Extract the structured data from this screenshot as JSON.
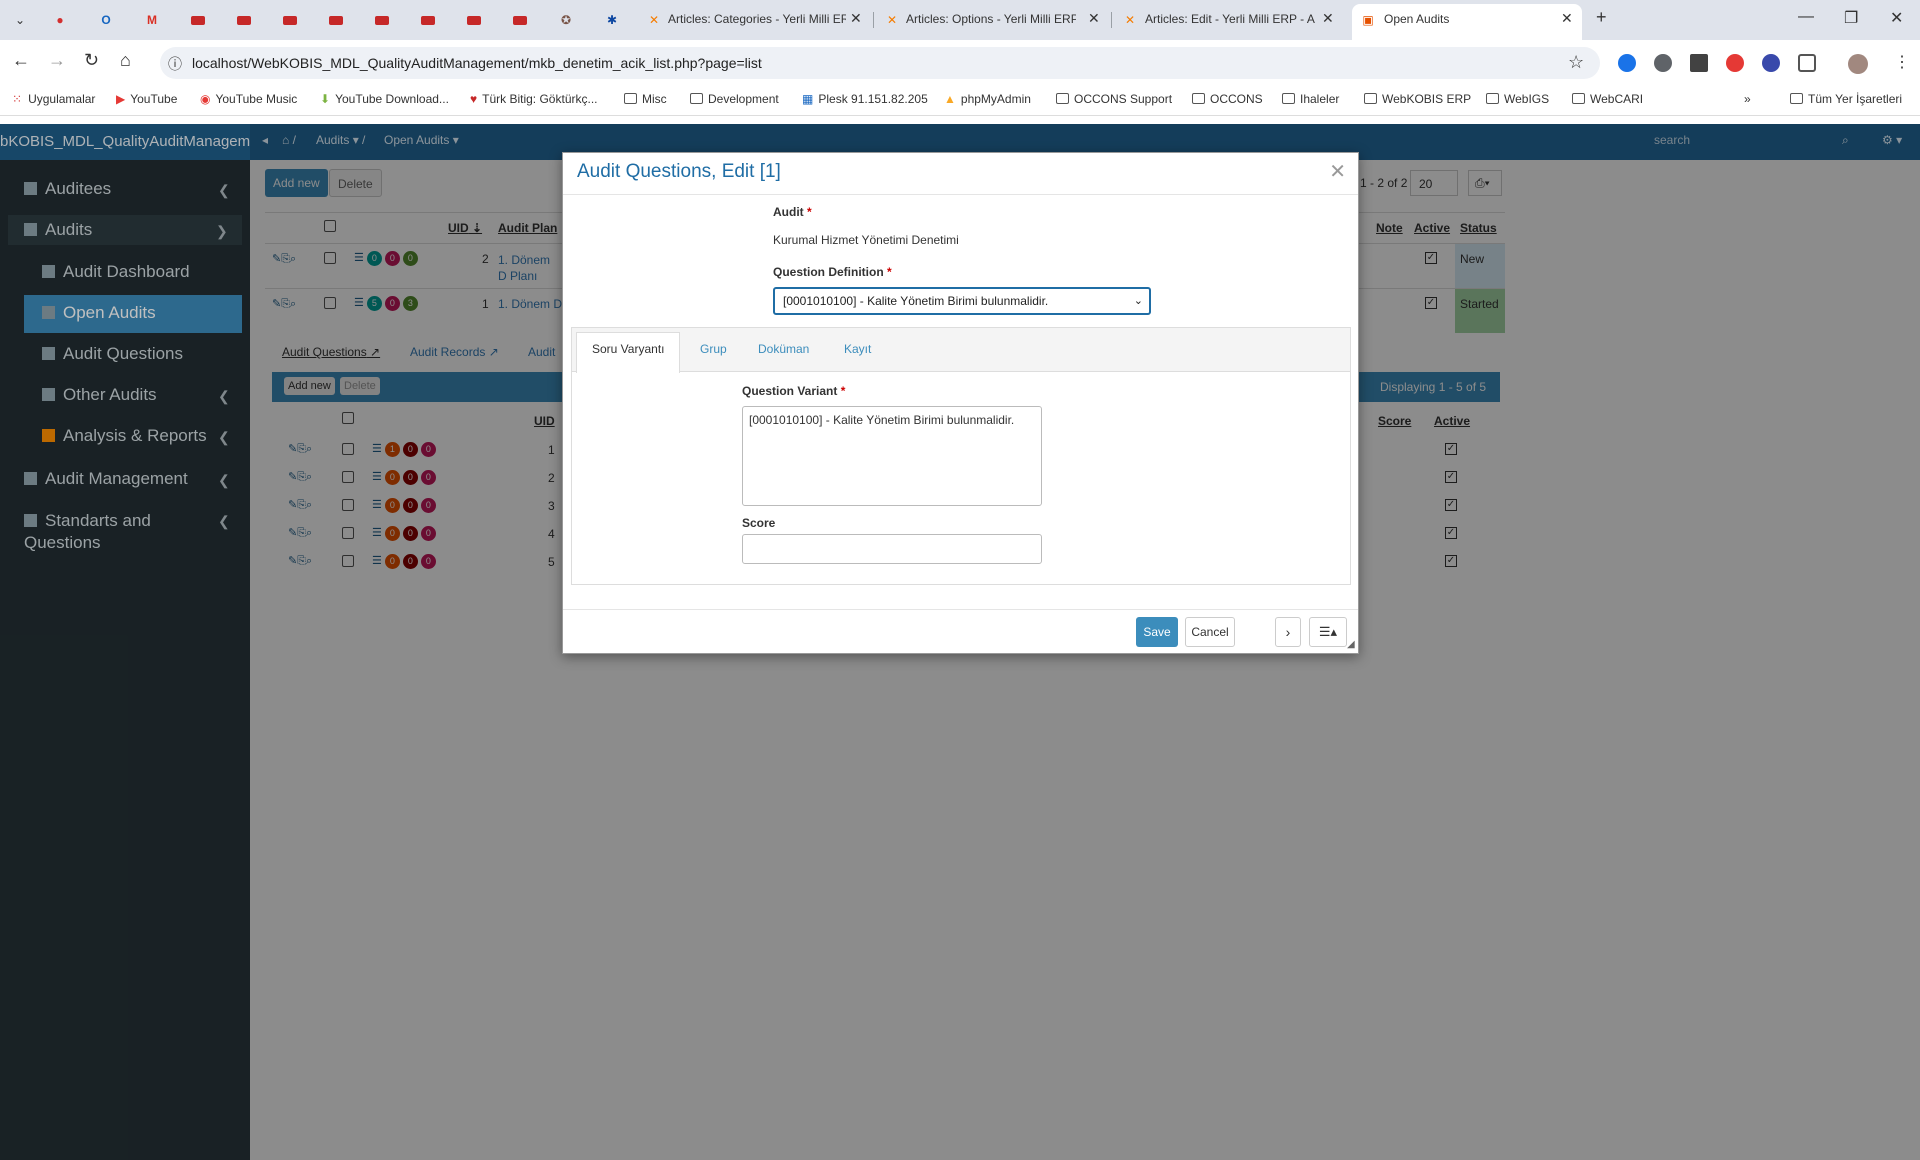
{
  "browser": {
    "tabs": [
      {
        "title": "Articles: Categories - Yerli Milli ERP"
      },
      {
        "title": "Articles: Options - Yerli Milli ERP"
      },
      {
        "title": "Articles: Edit - Yerli Milli ERP - A"
      },
      {
        "title": "Open Audits"
      }
    ],
    "url": "localhost/WebKOBIS_MDL_QualityAuditManagement/mkb_denetim_acik_list.php?page=list",
    "bookmarks": [
      "Uygulamalar",
      "YouTube",
      "YouTube Music",
      "YouTube Download...",
      "Türk Bitig: Göktürkç...",
      "Misc",
      "Development",
      "Plesk 91.151.82.205",
      "phpMyAdmin",
      "OCCONS Support",
      "OCCONS",
      "Ihaleler",
      "WebKOBIS ERP",
      "WebIGS",
      "WebCARI"
    ],
    "all_bookmarks": "Tüm Yer İşaretleri"
  },
  "app": {
    "brand": "bKOBIS_MDL_QualityAuditManagem",
    "breadcrumb": [
      "Audits",
      "Open Audits"
    ],
    "search_placeholder": "search"
  },
  "sidebar": {
    "items": [
      {
        "label": "Auditees"
      },
      {
        "label": "Audits"
      },
      {
        "label": "Audit Dashboard"
      },
      {
        "label": "Open Audits"
      },
      {
        "label": "Audit Questions"
      },
      {
        "label": "Other Audits"
      },
      {
        "label": "Analysis & Reports"
      },
      {
        "label": "Audit Management"
      },
      {
        "label": "Standarts and Questions"
      }
    ]
  },
  "list": {
    "add_new": "Add new",
    "delete": "Delete",
    "pager": "1 - 2 of 2",
    "page_size": "20",
    "headers": [
      "UID",
      "Audit Plan",
      "Note",
      "Active",
      "Status"
    ],
    "rows": [
      {
        "uid": "2",
        "plan": "1. Dönem D Planı",
        "status": "New",
        "pills": [
          "0",
          "0",
          "0"
        ]
      },
      {
        "uid": "1",
        "plan": "1. Dönem D",
        "status": "Started",
        "pills": [
          "5",
          "0",
          "3"
        ]
      }
    ],
    "detail_tabs": [
      "Audit Questions",
      "Audit Records",
      "Audit"
    ],
    "detail_display": "Displaying 1 - 5 of 5",
    "detail_headers": [
      "UID",
      "Score",
      "Active"
    ],
    "detail_rows": [
      {
        "uid": "1",
        "pills": [
          "1",
          "0",
          "0"
        ]
      },
      {
        "uid": "2",
        "pills": [
          "0",
          "0",
          "0"
        ]
      },
      {
        "uid": "3",
        "pills": [
          "0",
          "0",
          "0"
        ]
      },
      {
        "uid": "4",
        "pills": [
          "0",
          "0",
          "0"
        ]
      },
      {
        "uid": "5",
        "pills": [
          "0",
          "0",
          "0"
        ]
      }
    ]
  },
  "modal": {
    "title": "Audit Questions, Edit [1]",
    "audit_label": "Audit",
    "audit_value": "Kurumal Hizmet Yönetimi Denetimi",
    "question_def_label": "Question Definition",
    "question_def_value": "[0001010100] - Kalite Yönetim Birimi bulunmalidir.",
    "tabs": [
      "Soru Varyantı",
      "Grup",
      "Doküman",
      "Kayıt"
    ],
    "question_variant_label": "Question Variant",
    "question_variant_value": "[0001010100] - Kalite Yönetim Birimi bulunmalidir.",
    "score_label": "Score",
    "score_value": "",
    "save": "Save",
    "cancel": "Cancel"
  }
}
